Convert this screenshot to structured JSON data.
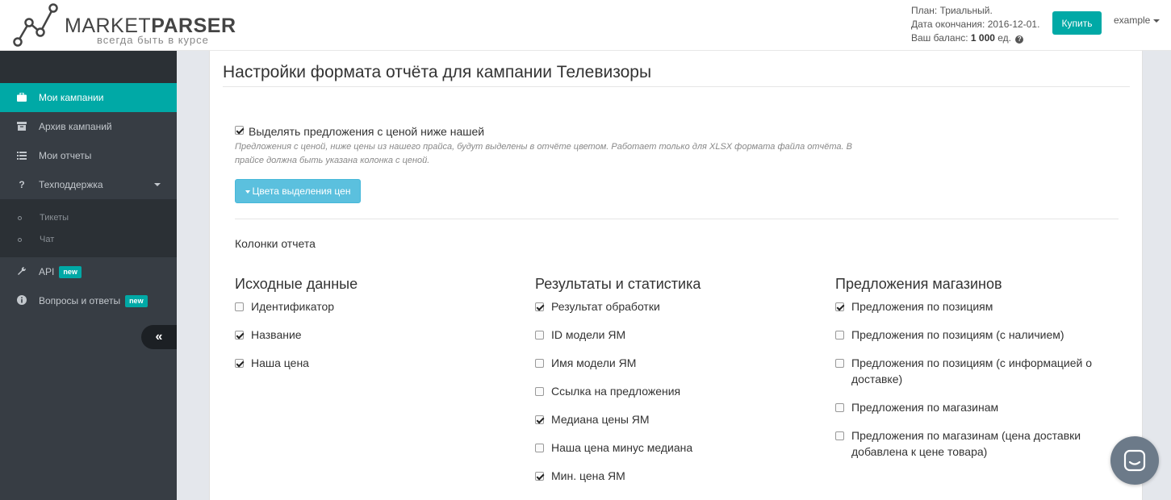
{
  "header": {
    "logo_prefix": "MARKET",
    "logo_bold": "PARSER",
    "logo_tagline": "всегда быть в курсе",
    "plan_label": "План: Триальный.",
    "expiry_label": "Дата окончания: 2016-12-01.",
    "balance_label": "Ваш баланс:",
    "balance_value": "1 000",
    "balance_unit": "ед.",
    "buy_button": "Купить",
    "username": "example"
  },
  "sidebar": {
    "items": [
      {
        "label": "Мои кампании",
        "icon": "briefcase-icon",
        "active": true
      },
      {
        "label": "Архив кампаний",
        "icon": "archive-icon"
      },
      {
        "label": "Мои отчеты",
        "icon": "list-icon"
      },
      {
        "label": "Техподдержка",
        "icon": "question-icon"
      }
    ],
    "support_sub": [
      "Тикеты",
      "Чат"
    ],
    "extra_items": [
      {
        "label": "API",
        "icon": "wrench-icon",
        "badge": "new"
      },
      {
        "label": "Вопросы и ответы",
        "icon": "info-icon",
        "badge": "new"
      }
    ],
    "collapse_glyph": "«"
  },
  "main": {
    "title": "Настройки формата отчёта для кампании Телевизоры",
    "highlight_option": {
      "label": "Выделять предложения с ценой ниже нашей",
      "checked": true,
      "help": "Предложения с ценой, ниже цены из нашего прайса, будут выделены в отчёте цветом. Работает только для XLSX формата файла отчёта. В прайсе должна быть указана колонка с ценой."
    },
    "colors_button": "Цвета выделения цен",
    "columns_label": "Колонки отчета",
    "groups": [
      {
        "title": "Исходные данные",
        "options": [
          {
            "label": "Идентификатор",
            "checked": false
          },
          {
            "label": "Название",
            "checked": true
          },
          {
            "label": "Наша цена",
            "checked": true
          }
        ]
      },
      {
        "title": "Результаты и статистика",
        "options": [
          {
            "label": "Результат обработки",
            "checked": true
          },
          {
            "label": "ID модели ЯМ",
            "checked": false
          },
          {
            "label": "Имя модели ЯМ",
            "checked": false
          },
          {
            "label": "Ссылка на предложения",
            "checked": false
          },
          {
            "label": "Медиана цены ЯМ",
            "checked": true
          },
          {
            "label": "Наша цена минус медиана",
            "checked": false
          },
          {
            "label": "Мин. цена ЯМ",
            "checked": true
          }
        ]
      },
      {
        "title": "Предложения магазинов",
        "options": [
          {
            "label": "Предложения по позициям",
            "checked": true
          },
          {
            "label": "Предложения по позициям (с наличием)",
            "checked": false
          },
          {
            "label": "Предложения по позициям (с информацией о доставке)",
            "checked": false
          },
          {
            "label": "Предложения по магазинам",
            "checked": false
          },
          {
            "label": "Предложения по магазинам (цена доставки добавлена к цене товара)",
            "checked": false
          }
        ]
      }
    ]
  },
  "colors": {
    "accent": "#00a9a6",
    "sidebar_bg": "#373d44",
    "info_button": "#5bc0de"
  }
}
